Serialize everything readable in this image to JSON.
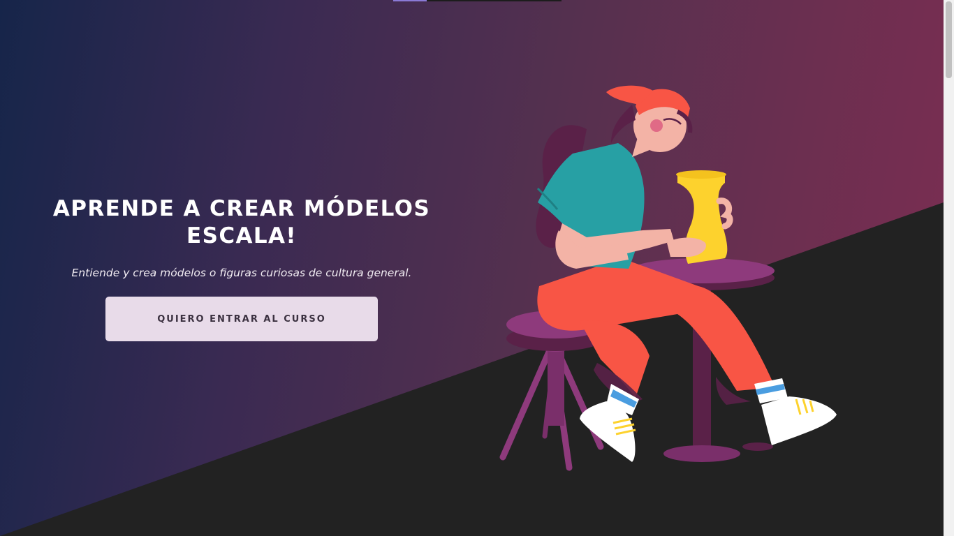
{
  "hero": {
    "title": "APRENDE A CREAR MÓDELOS ESCALA!",
    "subtitle": "Entiende y crea módelos o figuras curiosas de cultura general.",
    "cta_label": "QUIERO ENTRAR AL CURSO"
  },
  "illustration": {
    "icon": "pottery-woman-illustration"
  },
  "colors": {
    "gradient_start": "#16254a",
    "gradient_end": "#7c2d52",
    "floor": "#222222",
    "cta_background": "#e8dbe9",
    "cta_text": "#3b3140",
    "shirt": "#27a0a4",
    "pants": "#f85545",
    "vase": "#fdd22d",
    "furniture": "#8e3a7c"
  },
  "scrollbar": {
    "position_fraction": 0
  }
}
